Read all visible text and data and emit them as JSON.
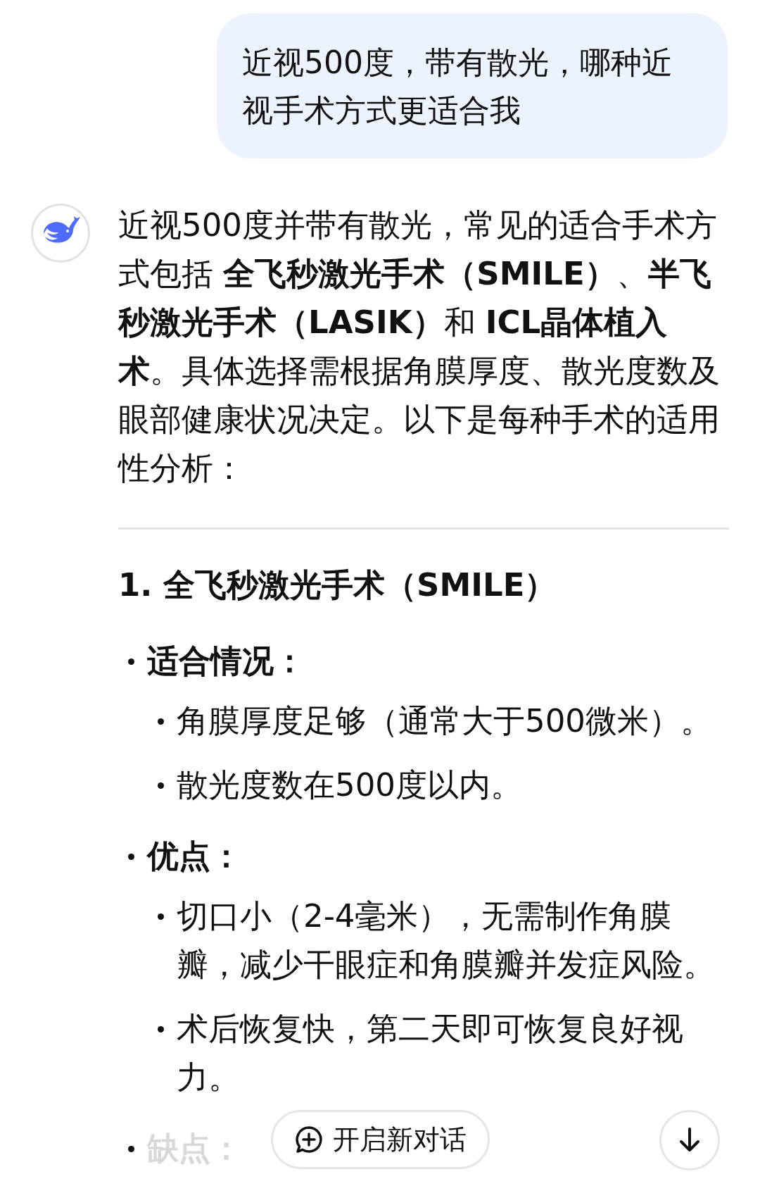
{
  "user_message": {
    "text": "近视500度，带有散光，哪种近视手术方式更适合我"
  },
  "assistant_message": {
    "paragraph": "近视500度并带有散光，常见的适合手术方式包括 **全飞秒激光手术（SMILE）**、**半飞秒激光手术（LASIK）**和 **ICL晶体植入术**。具体选择需根据角膜厚度、散光度数及眼部健康状况决定。以下是每种手术的适用性分析：",
    "heading": "1. 全飞秒激光手术（SMILE）",
    "list": [
      {
        "text": "适合情况：",
        "children": [
          {
            "text": "角膜厚度足够（通常大于500微米）。"
          },
          {
            "text": "散光度数在500度以内。"
          }
        ]
      },
      {
        "text": "优点：",
        "children": [
          {
            "text": "切口小（2-4毫米），无需制作角膜瓣，减少干眼症和角膜瓣并发症风险。"
          },
          {
            "text": "术后恢复快，第二天即可恢复良好视力。"
          }
        ]
      },
      {
        "text": "缺点：",
        "faded": true
      }
    ]
  },
  "new_chat_button": {
    "label": "开启新对话"
  }
}
